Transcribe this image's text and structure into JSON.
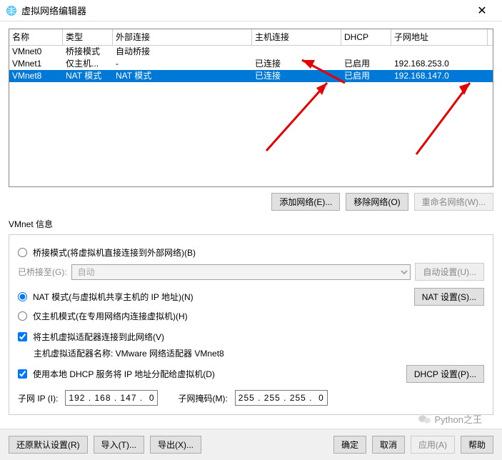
{
  "window": {
    "title": "虚拟网络编辑器"
  },
  "table": {
    "headers": {
      "name": "名称",
      "type": "类型",
      "ext": "外部连接",
      "host": "主机连接",
      "dhcp": "DHCP",
      "subnet": "子网地址"
    },
    "rows": [
      {
        "name": "VMnet0",
        "type": "桥接模式",
        "ext": "自动桥接",
        "host": "",
        "dhcp": "",
        "subnet": ""
      },
      {
        "name": "VMnet1",
        "type": "仅主机...",
        "ext": "-",
        "host": "已连接",
        "dhcp": "已启用",
        "subnet": "192.168.253.0"
      },
      {
        "name": "VMnet8",
        "type": "NAT 模式",
        "ext": "NAT 模式",
        "host": "已连接",
        "dhcp": "已启用",
        "subnet": "192.168.147.0"
      }
    ]
  },
  "buttons": {
    "add_net": "添加网络(E)...",
    "remove_net": "移除网络(O)",
    "rename_net": "重命名网络(W)...",
    "auto_set": "自动设置(U)...",
    "nat_set": "NAT 设置(S)...",
    "dhcp_set": "DHCP 设置(P)...",
    "restore": "还原默认设置(R)",
    "import": "导入(T)...",
    "export": "导出(X)...",
    "ok": "确定",
    "cancel": "取消",
    "apply": "应用(A)",
    "help": "帮助"
  },
  "labels": {
    "vmnet_info": "VMnet 信息",
    "bridge_mode": "桥接模式(将虚拟机直接连接到外部网络)(B)",
    "bridge_to": "已桥接至(G):",
    "bridge_auto": "自动",
    "nat_mode": "NAT 模式(与虚拟机共享主机的 IP 地址)(N)",
    "hostonly_mode": "仅主机模式(在专用网络内连接虚拟机)(H)",
    "connect_host": "将主机虚拟适配器连接到此网络(V)",
    "host_adapter": "主机虚拟适配器名称: VMware 网络适配器 VMnet8",
    "use_dhcp": "使用本地 DHCP 服务将 IP 地址分配给虚拟机(D)",
    "subnet_ip": "子网 IP (I):",
    "subnet_mask": "子网掩码(M):"
  },
  "values": {
    "subnet_ip": "192 . 168 . 147 .  0",
    "subnet_mask": "255 . 255 . 255 .  0"
  },
  "watermark": "Python之王"
}
